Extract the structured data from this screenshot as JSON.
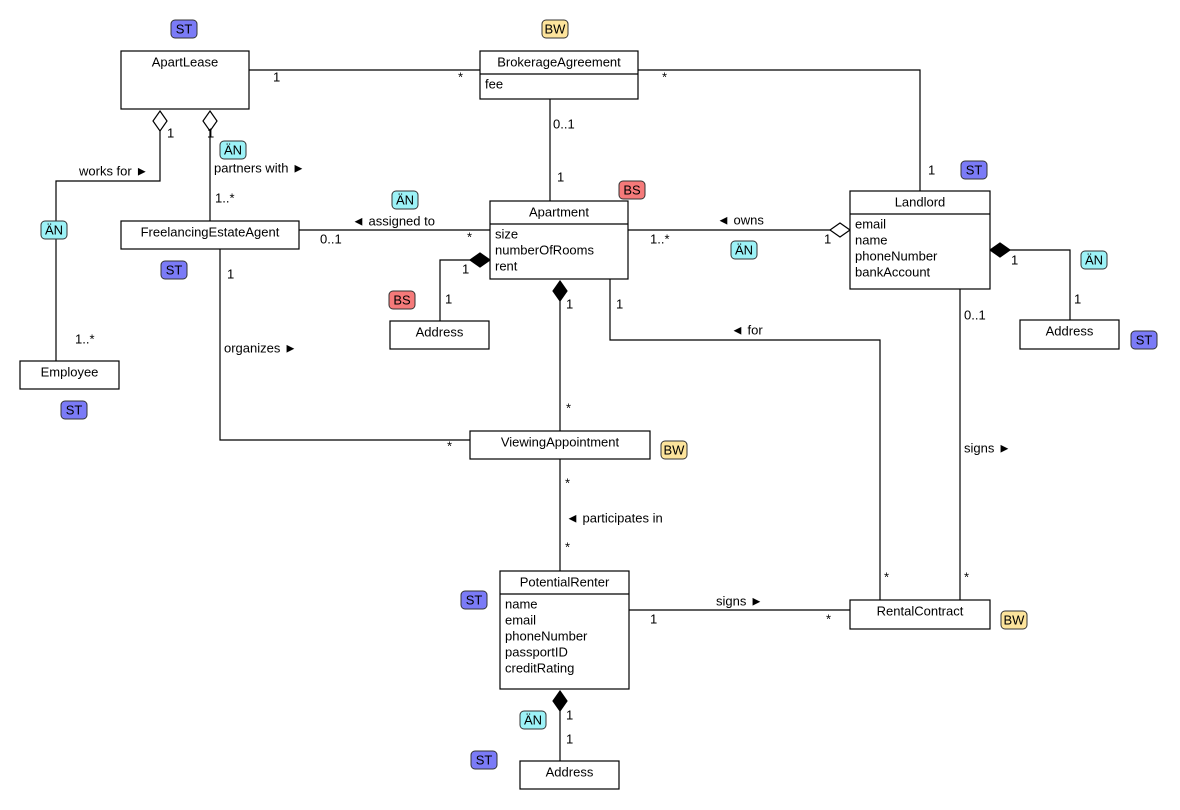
{
  "classes": [
    {
      "id": "apartlease",
      "name": "ApartLease",
      "attributes": []
    },
    {
      "id": "brokerage",
      "name": "BrokerageAgreement",
      "attributes": [
        "fee"
      ]
    },
    {
      "id": "agent",
      "name": "FreelancingEstateAgent",
      "attributes": []
    },
    {
      "id": "apartment",
      "name": "Apartment",
      "attributes": [
        "size",
        "numberOfRooms",
        "rent"
      ]
    },
    {
      "id": "landlord",
      "name": "Landlord",
      "attributes": [
        "email",
        "name",
        "phoneNumber",
        "bankAccount"
      ]
    },
    {
      "id": "address-apartment",
      "name": "Address",
      "attributes": []
    },
    {
      "id": "address-landlord",
      "name": "Address",
      "attributes": []
    },
    {
      "id": "employee",
      "name": "Employee",
      "attributes": []
    },
    {
      "id": "viewing",
      "name": "ViewingAppointment",
      "attributes": []
    },
    {
      "id": "renter",
      "name": "PotentialRenter",
      "attributes": [
        "name",
        "email",
        "phoneNumber",
        "passportID",
        "creditRating"
      ]
    },
    {
      "id": "contract",
      "name": "RentalContract",
      "attributes": []
    },
    {
      "id": "address-renter",
      "name": "Address",
      "attributes": []
    }
  ],
  "tag_colors": {
    "ST": "#7b7bf7",
    "BW": "#fde49c",
    "ÄN": "#9cf2f7",
    "BS": "#f57a7a"
  },
  "tags": [
    "ST",
    "BW",
    "ÄN",
    "ÄN",
    "BS",
    "ST",
    "ÄN",
    "BS",
    "ST",
    "ÄN",
    "ÄN",
    "ST",
    "ST",
    "BW",
    "ST",
    "BW",
    "ÄN",
    "ST"
  ],
  "associations": [
    {
      "from": "ApartLease",
      "to": "BrokerageAgreement",
      "name": "",
      "kind": "association",
      "multiplicities": [
        "1",
        "*"
      ]
    },
    {
      "from": "BrokerageAgreement",
      "to": "Landlord",
      "name": "",
      "kind": "association",
      "multiplicities": [
        "*",
        "1"
      ]
    },
    {
      "from": "BrokerageAgreement",
      "to": "Apartment",
      "name": "",
      "kind": "association",
      "multiplicities": [
        "0..1",
        "1"
      ]
    },
    {
      "from": "ApartLease",
      "to": "Employee",
      "name": "works for ►",
      "kind": "aggregation",
      "multiplicities": [
        "1",
        "1..*"
      ]
    },
    {
      "from": "ApartLease",
      "to": "FreelancingEstateAgent",
      "name": "partners with ►",
      "kind": "aggregation",
      "multiplicities": [
        "1",
        "1..*"
      ]
    },
    {
      "from": "FreelancingEstateAgent",
      "to": "Apartment",
      "name": "◄ assigned to",
      "kind": "association",
      "multiplicities": [
        "0..1",
        "*"
      ]
    },
    {
      "from": "FreelancingEstateAgent",
      "to": "ViewingAppointment",
      "name": "organizes ►",
      "kind": "association",
      "multiplicities": [
        "1",
        "*"
      ]
    },
    {
      "from": "Apartment",
      "to": "Landlord",
      "name": "◄ owns",
      "kind": "aggregation",
      "multiplicities": [
        "1..*",
        "1"
      ]
    },
    {
      "from": "Apartment",
      "to": "Address",
      "name": "",
      "kind": "composition",
      "multiplicities": [
        "1",
        "1"
      ]
    },
    {
      "from": "Apartment",
      "to": "ViewingAppointment",
      "name": "",
      "kind": "composition",
      "multiplicities": [
        "1",
        "*"
      ]
    },
    {
      "from": "Apartment",
      "to": "RentalContract",
      "name": "◄ for",
      "kind": "association",
      "multiplicities": [
        "1",
        "*"
      ]
    },
    {
      "from": "Landlord",
      "to": "Address",
      "name": "",
      "kind": "composition",
      "multiplicities": [
        "1",
        "1"
      ]
    },
    {
      "from": "Landlord",
      "to": "RentalContract",
      "name": "signs ►",
      "kind": "association",
      "multiplicities": [
        "0..1",
        "*"
      ]
    },
    {
      "from": "ViewingAppointment",
      "to": "PotentialRenter",
      "name": "◄ participates in",
      "kind": "association",
      "multiplicities": [
        "*",
        "*"
      ]
    },
    {
      "from": "PotentialRenter",
      "to": "RentalContract",
      "name": "signs ►",
      "kind": "association",
      "multiplicities": [
        "1",
        "*"
      ]
    },
    {
      "from": "PotentialRenter",
      "to": "Address",
      "name": "",
      "kind": "composition",
      "multiplicities": [
        "1",
        "1"
      ]
    }
  ]
}
